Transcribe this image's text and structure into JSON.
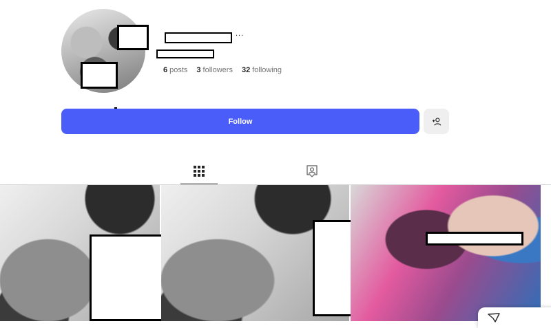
{
  "profile": {
    "more_label": "...",
    "stats": {
      "posts_count": "6",
      "posts_label": "posts",
      "followers_count": "3",
      "followers_label": "followers",
      "following_count": "32",
      "following_label": "following"
    }
  },
  "actions": {
    "follow_label": "Follow",
    "suggest_icon": "person-add-icon"
  },
  "tabs": [
    {
      "name": "posts",
      "icon": "grid-icon",
      "active": true
    },
    {
      "name": "tagged",
      "icon": "tagged-icon",
      "active": false
    }
  ],
  "colors": {
    "primary": "#4a5df9",
    "secondary_button": "#efefef",
    "muted_text": "#737373",
    "divider": "#dbdbdb"
  }
}
